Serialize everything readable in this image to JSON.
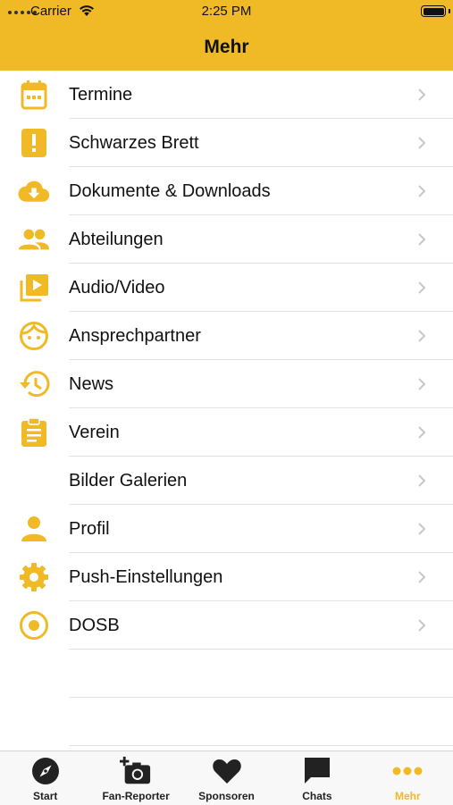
{
  "status_bar": {
    "carrier": "Carrier",
    "time": "2:25 PM"
  },
  "header": {
    "title": "Mehr"
  },
  "menu": {
    "items": [
      {
        "label": "Termine",
        "icon": "calendar-icon"
      },
      {
        "label": "Schwarzes Brett",
        "icon": "notice-board-icon"
      },
      {
        "label": "Dokumente & Downloads",
        "icon": "cloud-download-icon"
      },
      {
        "label": "Abteilungen",
        "icon": "people-icon"
      },
      {
        "label": "Audio/Video",
        "icon": "video-library-icon"
      },
      {
        "label": "Ansprechpartner",
        "icon": "face-icon"
      },
      {
        "label": "News",
        "icon": "history-icon"
      },
      {
        "label": "Verein",
        "icon": "clipboard-icon"
      },
      {
        "label": "Bilder Galerien",
        "icon": ""
      },
      {
        "label": "Profil",
        "icon": "person-icon"
      },
      {
        "label": "Push-Einstellungen",
        "icon": "gear-icon"
      },
      {
        "label": "DOSB",
        "icon": "record-icon"
      }
    ]
  },
  "tabbar": {
    "tabs": [
      {
        "label": "Start",
        "icon": "compass-icon",
        "active": false
      },
      {
        "label": "Fan-Reporter",
        "icon": "add-photo-icon",
        "active": false
      },
      {
        "label": "Sponsoren",
        "icon": "heart-icon",
        "active": false
      },
      {
        "label": "Chats",
        "icon": "chat-icon",
        "active": false
      },
      {
        "label": "Mehr",
        "icon": "more-icon",
        "active": true
      }
    ]
  },
  "colors": {
    "accent": "#F0BA27",
    "text": "#111111",
    "chevron": "#c7c7cc",
    "divider": "#e3e3e3"
  }
}
